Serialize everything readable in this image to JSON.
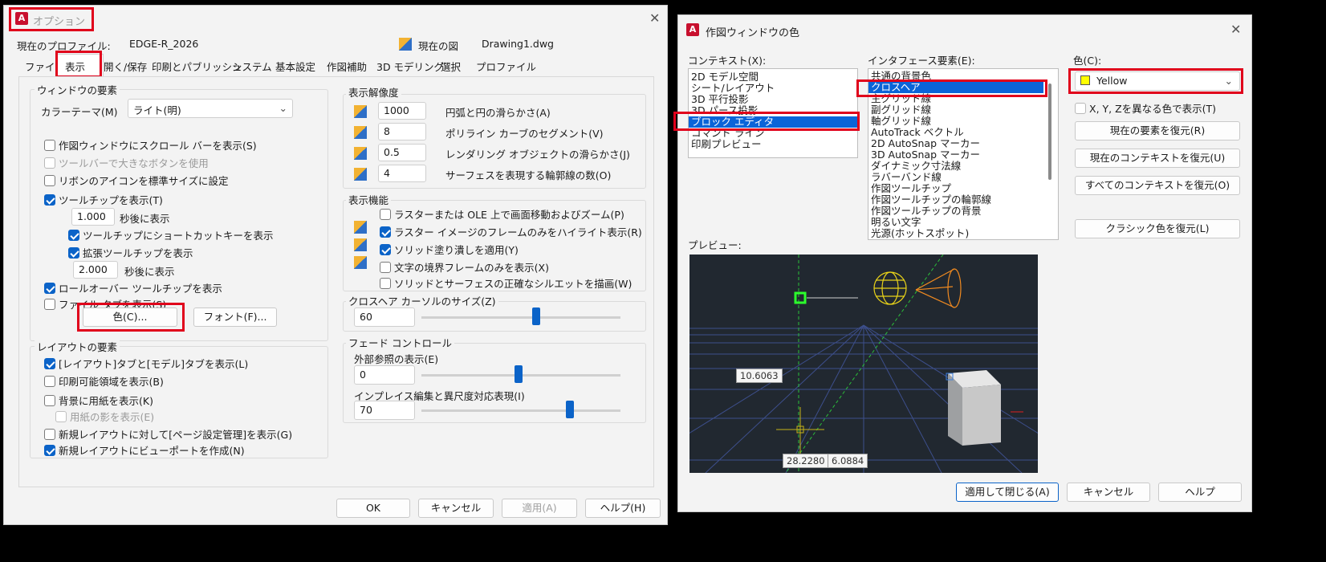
{
  "options": {
    "title": "オプション",
    "profile_label": "現在のプロファイル:",
    "profile_value": "EDGE-R_2026",
    "drawing_label": "現在の図",
    "drawing_value": "Drawing1.dwg",
    "tabs": [
      "ファイル",
      "表示",
      "開く/保存",
      "印刷とパブリッシュ",
      "システム",
      "基本設定",
      "作図補助",
      "3D モデリング",
      "選択",
      "プロファイル"
    ],
    "window_elements": {
      "title": "ウィンドウの要素",
      "color_theme_label": "カラーテーマ(M)",
      "color_theme_value": "ライト(明)",
      "scrollbars": "作図ウィンドウにスクロール バーを表示(S)",
      "large_buttons": "ツールバーで大きなボタンを使用",
      "ribbon_icons": "リボンのアイコンを標準サイズに設定",
      "tooltips": "ツールチップを表示(T)",
      "tooltip_delay": "1.000",
      "seconds_after": "秒後に表示",
      "shortcut_keys": "ツールチップにショートカットキーを表示",
      "extended_tooltips": "拡張ツールチップを表示",
      "extended_delay": "2.000",
      "seconds_after2": "秒後に表示",
      "rollover": "ロールオーバー ツールチップを表示",
      "file_tabs": "ファイル タブを表示(S)",
      "colors_button": "色(C)...",
      "fonts_button": "フォント(F)..."
    },
    "layout_elements": {
      "title": "レイアウトの要素",
      "layout_model_tabs": "[レイアウト]タブと[モデル]タブを表示(L)",
      "printable_area": "印刷可能領域を表示(B)",
      "paper_background": "背景に用紙を表示(K)",
      "paper_shadow": "用紙の影を表示(E)",
      "page_setup": "新規レイアウトに対して[ページ設定管理]を表示(G)",
      "create_viewport": "新規レイアウトにビューポートを作成(N)"
    },
    "display_resolution": {
      "title": "表示解像度",
      "rows": [
        {
          "value": "1000",
          "label": "円弧と円の滑らかさ(A)"
        },
        {
          "value": "8",
          "label": "ポリライン カーブのセグメント(V)"
        },
        {
          "value": "0.5",
          "label": "レンダリング オブジェクトの滑らかさ(J)"
        },
        {
          "value": "4",
          "label": "サーフェスを表現する輪郭線の数(O)"
        }
      ]
    },
    "display_performance": {
      "title": "表示機能",
      "rows": [
        {
          "label": "ラスターまたは OLE 上で画面移動およびズーム(P)",
          "checked": false
        },
        {
          "label": "ラスター イメージのフレームのみをハイライト表示(R)",
          "checked": true
        },
        {
          "label": "ソリッド塗り潰しを適用(Y)",
          "checked": true
        },
        {
          "label": "文字の境界フレームのみを表示(X)",
          "checked": false
        },
        {
          "label": "ソリッドとサーフェスの正確なシルエットを描画(W)",
          "checked": false
        }
      ]
    },
    "crosshair": {
      "title": "クロスヘア カーソルのサイズ(Z)",
      "value": "60",
      "fraction": 0.55
    },
    "fade": {
      "title": "フェード コントロール",
      "xref_label": "外部参照の表示(E)",
      "xref_value": "0",
      "xref_fraction": 0.5,
      "inplace_label": "インプレイス編集と異尺度対応表現(I)",
      "inplace_value": "70",
      "inplace_fraction": 0.75
    },
    "buttons": {
      "ok": "OK",
      "cancel": "キャンセル",
      "apply": "適用(A)",
      "help": "ヘルプ(H)"
    }
  },
  "colors": {
    "title": "作図ウィンドウの色",
    "context_label": "コンテキスト(X):",
    "contexts": [
      "2D モデル空間",
      "シート/レイアウト",
      "3D 平行投影",
      "3D パース投影",
      "ブロック エディタ",
      "コマンド ライン",
      "印刷プレビュー"
    ],
    "selected_context": 4,
    "element_label": "インタフェース要素(E):",
    "elements": [
      "共通の背景色",
      "クロスヘア",
      "主グリッド線",
      "副グリッド線",
      "軸グリッド線",
      "AutoTrack ベクトル",
      "2D AutoSnap マーカー",
      "3D AutoSnap マーカー",
      "ダイナミック寸法線",
      "ラバーバンド線",
      "作図ツールチップ",
      "作図ツールチップの輪郭線",
      "作図ツールチップの背景",
      "明るい文字",
      "光源(ホットスポット)"
    ],
    "selected_element": 1,
    "color_label": "色(C):",
    "color_value": "Yellow",
    "color_hex": "#ffff00",
    "xyz_label": "X, Y, Zを異なる色で表示(T)",
    "restore_current_element": "現在の要素を復元(R)",
    "restore_current_context": "現在のコンテキストを復元(U)",
    "restore_all": "すべてのコンテキストを復元(O)",
    "restore_classic": "クラシック色を復元(L)",
    "preview_label": "プレビュー:",
    "preview_values": {
      "a": "10.6063",
      "b": "28.2280",
      "c": "6.0884"
    },
    "buttons": {
      "apply_close": "適用して閉じる(A)",
      "cancel": "キャンセル",
      "help": "ヘルプ"
    }
  }
}
